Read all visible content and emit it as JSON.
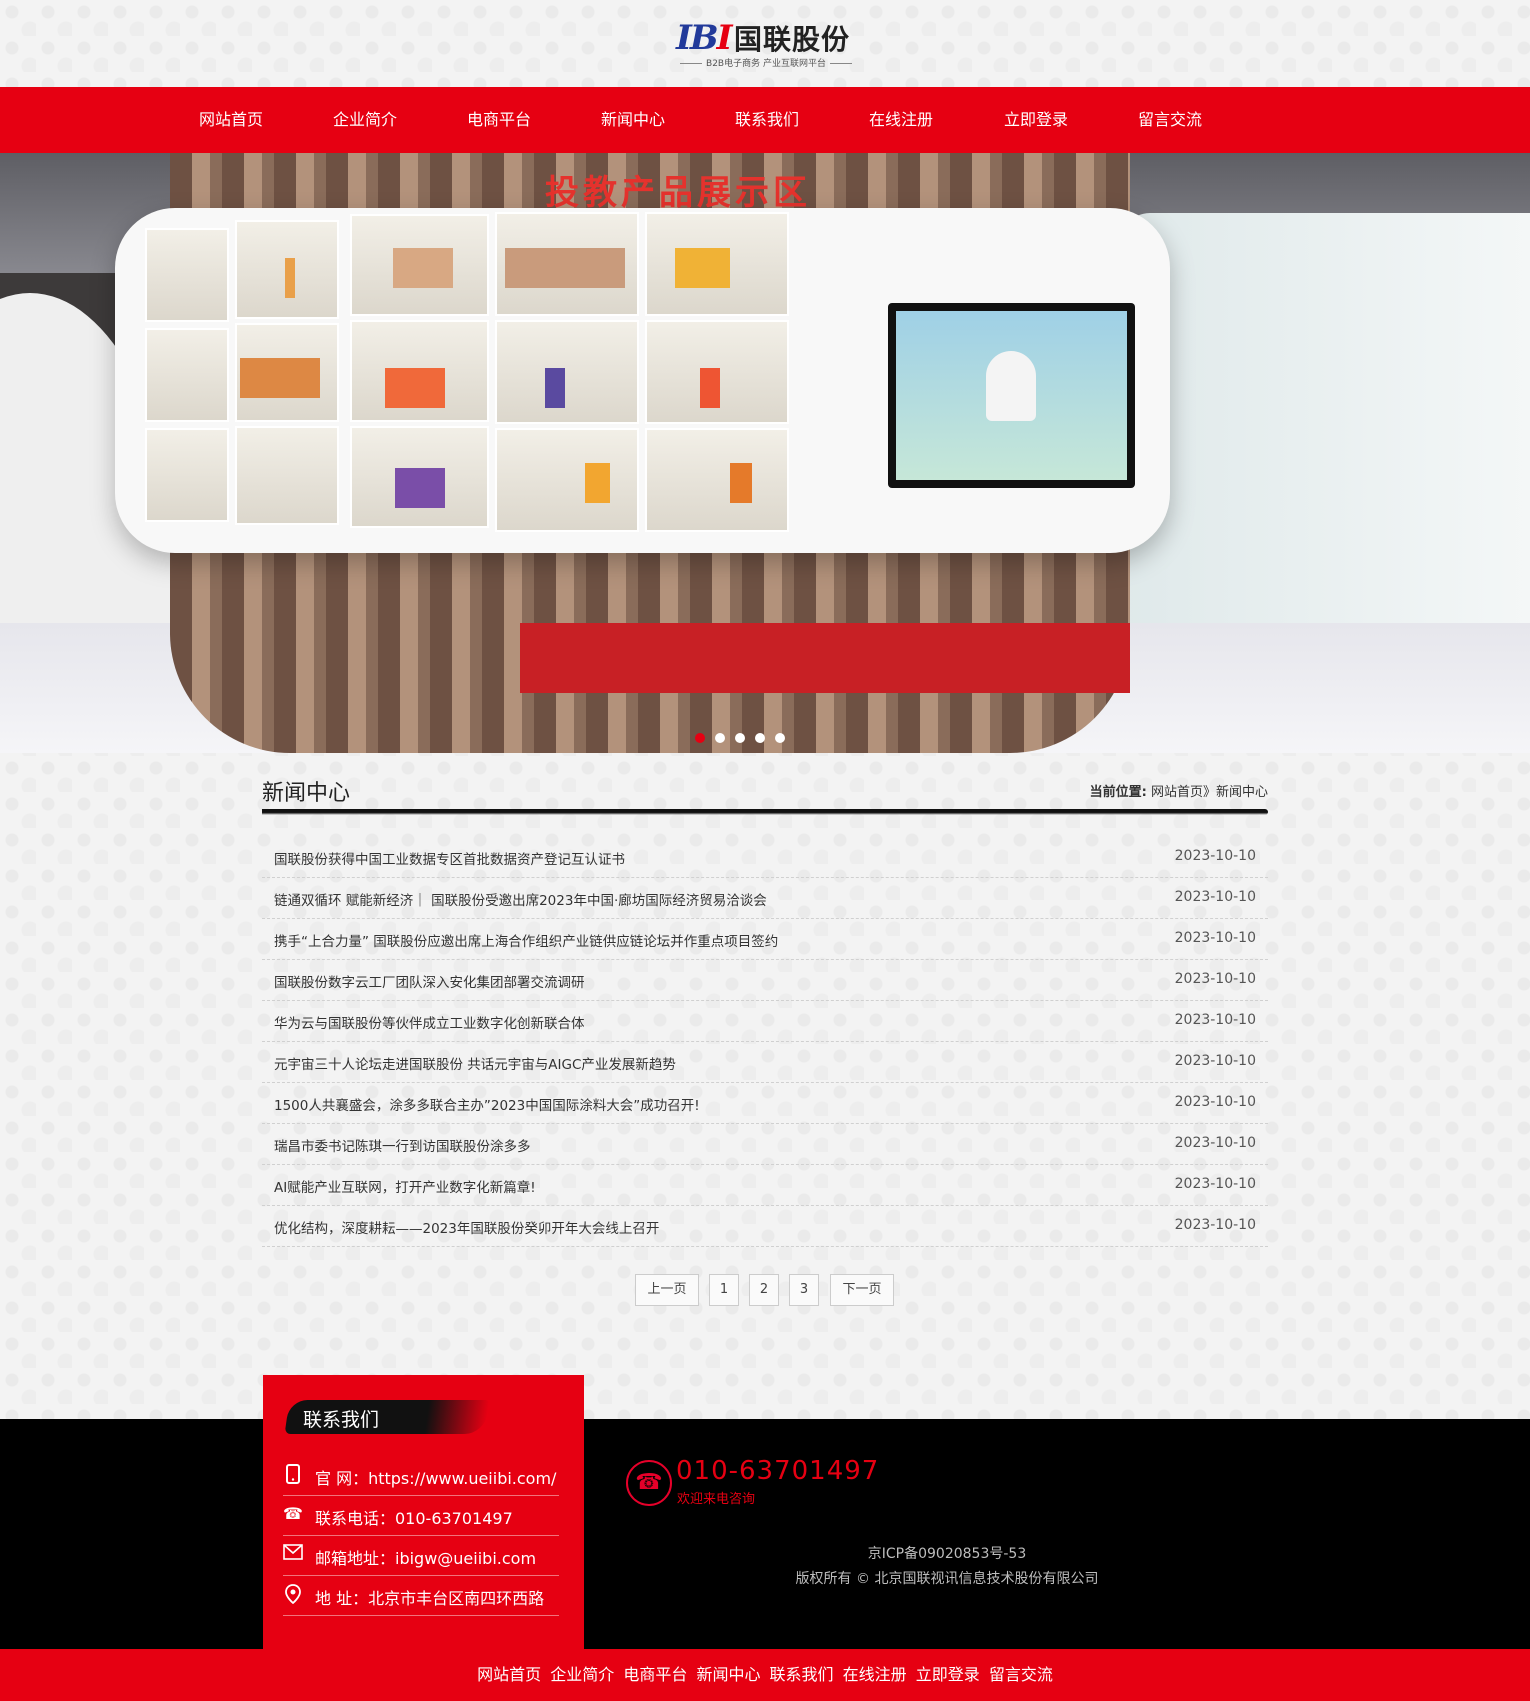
{
  "header": {
    "logo_mark_a": "IB",
    "logo_mark_b": "I",
    "logo_name": "国联股份",
    "logo_tagline": "B2B电子商务 产业互联网平台"
  },
  "nav": {
    "items": [
      "网站首页",
      "企业简介",
      "电商平台",
      "新闻中心",
      "联系我们",
      "在线注册",
      "立即登录",
      "留言交流"
    ]
  },
  "banner": {
    "sign_text": "投教产品展示区",
    "slide_count": 5,
    "active_slide": 1
  },
  "main": {
    "section_title": "新闻中心",
    "breadcrumb_label": "当前位置:",
    "breadcrumb_home": "网站首页》",
    "breadcrumb_current": "新闻中心",
    "news": [
      {
        "title": "国联股份获得中国工业数据专区首批数据资产登记互认证书",
        "date": "2023-10-10"
      },
      {
        "title": "链通双循环 赋能新经济｜ 国联股份受邀出席2023年中国·廊坊国际经济贸易洽谈会",
        "date": "2023-10-10"
      },
      {
        "title": "携手“上合力量” 国联股份应邀出席上海合作组织产业链供应链论坛并作重点项目签约",
        "date": "2023-10-10"
      },
      {
        "title": "国联股份数字云工厂团队深入安化集团部署交流调研",
        "date": "2023-10-10"
      },
      {
        "title": "华为云与国联股份等伙伴成立工业数字化创新联合体",
        "date": "2023-10-10"
      },
      {
        "title": "元宇宙三十人论坛走进国联股份 共话元宇宙与AIGC产业发展新趋势",
        "date": "2023-10-10"
      },
      {
        "title": "1500人共襄盛会，涂多多联合主办”2023中国国际涂料大会”成功召开!",
        "date": "2023-10-10"
      },
      {
        "title": "瑞昌市委书记陈琪一行到访国联股份涂多多",
        "date": "2023-10-10"
      },
      {
        "title": "AI赋能产业互联网，打开产业数字化新篇章!",
        "date": "2023-10-10"
      },
      {
        "title": "优化结构，深度耕耘——2023年国联股份癸卯开年大会线上召开",
        "date": "2023-10-10"
      }
    ]
  },
  "pager": {
    "prev": "上一页",
    "pages": [
      "1",
      "2",
      "3"
    ],
    "next": "下一页"
  },
  "contact": {
    "title": "联系我们",
    "rows": [
      {
        "icon": "mobile-icon",
        "text": "官 网：https://www.ueiibi.com/"
      },
      {
        "icon": "telephone-icon",
        "text": "联系电话：010-63701497"
      },
      {
        "icon": "mail-icon",
        "text": "邮箱地址：ibigw@ueiibi.com"
      },
      {
        "icon": "location-pin-icon",
        "text": "地 址：北京市丰台区南四环西路"
      }
    ],
    "hotline": "010-63701497",
    "hotline_sub": "欢迎来电咨询",
    "icp": "京ICP备09020853号-53",
    "copyright": "版权所有 © 北京国联视讯信息技术股份有限公司"
  },
  "footer_nav": {
    "items": [
      "网站首页",
      "企业简介",
      "电商平台",
      "新闻中心",
      "联系我们",
      "在线注册",
      "立即登录",
      "留言交流"
    ]
  },
  "colors": {
    "brand_red": "#e60012",
    "logo_blue": "#223a9a",
    "footer_black": "#000000"
  }
}
